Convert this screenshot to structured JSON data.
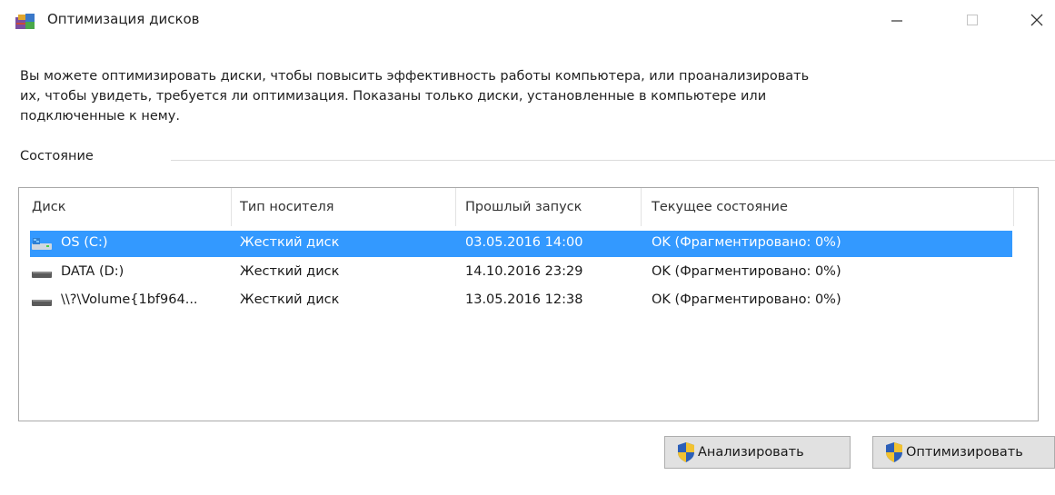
{
  "window": {
    "title": "Оптимизация дисков",
    "icon": "defrag-app-icon"
  },
  "description": [
    "Вы можете оптимизировать диски, чтобы повысить эффективность работы  компьютера, или проанализировать",
    "их, чтобы увидеть, требуется ли оптимизация. Показаны только диски, установленные в компьютере или",
    "подключенные к нему."
  ],
  "status_label": "Состояние",
  "table": {
    "columns": [
      "Диск",
      "Тип носителя",
      "Прошлый запуск",
      "Текущее состояние"
    ],
    "rows": [
      {
        "drive": "OS (C:)",
        "media": "Жесткий диск",
        "last_run": "03.05.2016 14:00",
        "status": "OK (Фрагментировано: 0%)",
        "selected": true,
        "icon": "system-drive-icon"
      },
      {
        "drive": "DATA (D:)",
        "media": "Жесткий диск",
        "last_run": "14.10.2016 23:29",
        "status": "OK (Фрагментировано: 0%)",
        "selected": false,
        "icon": "hard-drive-icon"
      },
      {
        "drive": "\\\\?\\Volume{1bf964...",
        "media": "Жесткий диск",
        "last_run": "13.05.2016 12:38",
        "status": "OK (Фрагментировано: 0%)",
        "selected": false,
        "icon": "hard-drive-icon"
      }
    ]
  },
  "buttons": {
    "analyze": "Анализировать",
    "optimize": "Оптимизировать",
    "icon": "uac-shield-icon"
  },
  "colors": {
    "selection": "#3399ff"
  }
}
